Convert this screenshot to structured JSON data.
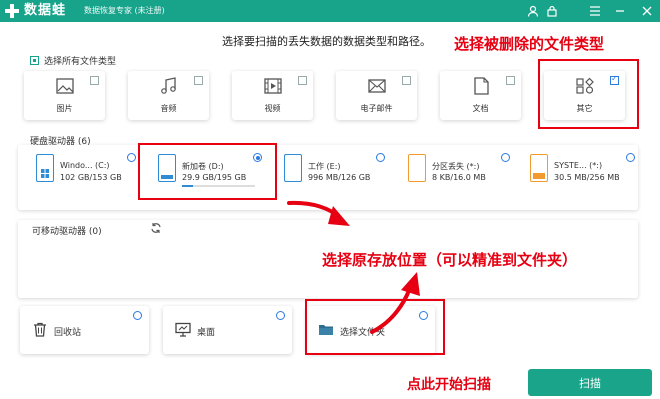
{
  "app": {
    "name": "数据蛙",
    "subtitle": "数据恢复专家 (未注册)",
    "titlebar_icons": [
      "user-icon",
      "lock-icon",
      "menu-icon",
      "minimize-icon",
      "close-icon"
    ]
  },
  "colors": {
    "brand": "#17a48b",
    "annotation": "#e60012",
    "accent": "#2a7ae2"
  },
  "instruction": "选择要扫描的丢失数据的数据类型和路径。",
  "annotations": {
    "choose_type": "选择被删除的文件类型",
    "choose_location": "选择原存放位置（可以精准到文件夹）",
    "click_scan": "点此开始扫描"
  },
  "file_types": {
    "select_all_label": "选择所有文件类型",
    "select_all_checked": true,
    "items": [
      {
        "label": "图片",
        "icon": "image-icon",
        "checked": false
      },
      {
        "label": "音频",
        "icon": "music-icon",
        "checked": false
      },
      {
        "label": "视频",
        "icon": "video-icon",
        "checked": false
      },
      {
        "label": "电子邮件",
        "icon": "mail-icon",
        "checked": false
      },
      {
        "label": "文档",
        "icon": "document-icon",
        "checked": false
      },
      {
        "label": "其它",
        "icon": "other-icon",
        "checked": true
      }
    ]
  },
  "hard_drives": {
    "label": "硬盘驱动器 (6)",
    "items": [
      {
        "name": "Windo... (C:)",
        "size": "102 GB/153 GB",
        "selected": false,
        "used": 0.67
      },
      {
        "name": "新加卷 (D:)",
        "size": "29.9 GB/195 GB",
        "selected": true,
        "used": 0.15
      },
      {
        "name": "工作 (E:)",
        "size": "996 MB/126 GB",
        "selected": false,
        "used": 0.01
      },
      {
        "name": "分区丢失 (*:)",
        "size": "8 KB/16.0 MB",
        "selected": false,
        "used": 0.0
      },
      {
        "name": "SYSTE... (*:)",
        "size": "30.5 MB/256 MB",
        "selected": false,
        "used": 0.12
      }
    ]
  },
  "removable": {
    "label": "可移动驱动器 (0)",
    "refresh_icon": "refresh-icon"
  },
  "locations": [
    {
      "label": "回收站",
      "icon": "trash-icon"
    },
    {
      "label": "桌面",
      "icon": "desktop-icon"
    },
    {
      "label": "选择文件夹",
      "icon": "folder-icon"
    }
  ],
  "scan_button": "扫描"
}
